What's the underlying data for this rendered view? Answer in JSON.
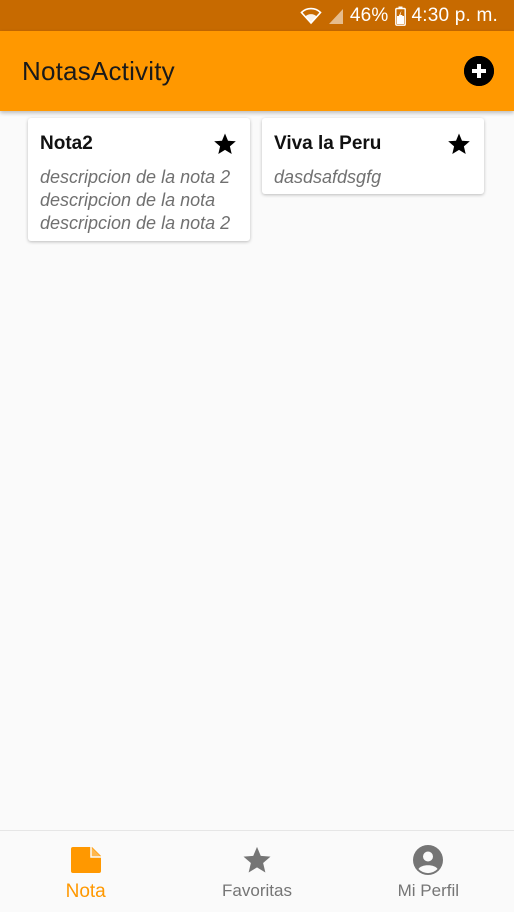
{
  "colors": {
    "status_bar": "#c76a00",
    "app_bar": "#ff9800",
    "accent": "#ff9800",
    "inactive": "#757575",
    "background": "#fafafa"
  },
  "status_bar": {
    "battery": "46%",
    "time": "4:30 p. m.",
    "icons": [
      "wifi-icon",
      "signal-icon",
      "battery-icon"
    ]
  },
  "app_bar": {
    "title": "NotasActivity",
    "add_icon": "add-circle-icon"
  },
  "notes": [
    {
      "title": "Nota2",
      "description": "descripcion de la nota 2 descripcion de la nota descripcion de la nota 2",
      "icon": "star-icon"
    },
    {
      "title": "Viva la Peru",
      "description": "dasdsafdsgfg",
      "icon": "star-icon"
    }
  ],
  "bottom_nav": {
    "items": [
      {
        "label": "Nota",
        "icon": "note-icon",
        "active": true
      },
      {
        "label": "Favoritas",
        "icon": "star-icon",
        "active": false
      },
      {
        "label": "Mi Perfil",
        "icon": "account-icon",
        "active": false
      }
    ]
  }
}
